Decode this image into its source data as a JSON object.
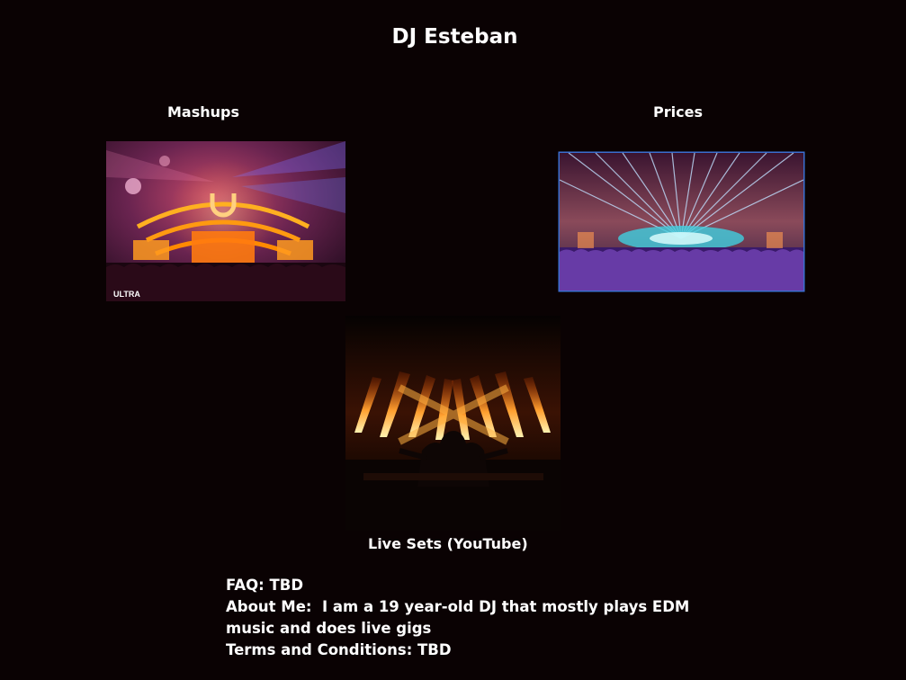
{
  "site": {
    "title": "DJ Esteban"
  },
  "nav": {
    "mashups_label": "Mashups",
    "prices_label": "Prices",
    "live_sets_label": "Live Sets (YouTube)"
  },
  "images": {
    "mashups_logo_text": "ULTRA"
  },
  "info": {
    "faq": "FAQ: TBD",
    "about_line1": "About Me:  I am a 19 year-old DJ that mostly plays EDM",
    "about_line2": "music and does live gigs",
    "terms": "Terms and Conditions: TBD"
  },
  "colors": {
    "background": "#0a0203",
    "text": "#ffffff",
    "prices_image_border": "#3a6fd0"
  }
}
